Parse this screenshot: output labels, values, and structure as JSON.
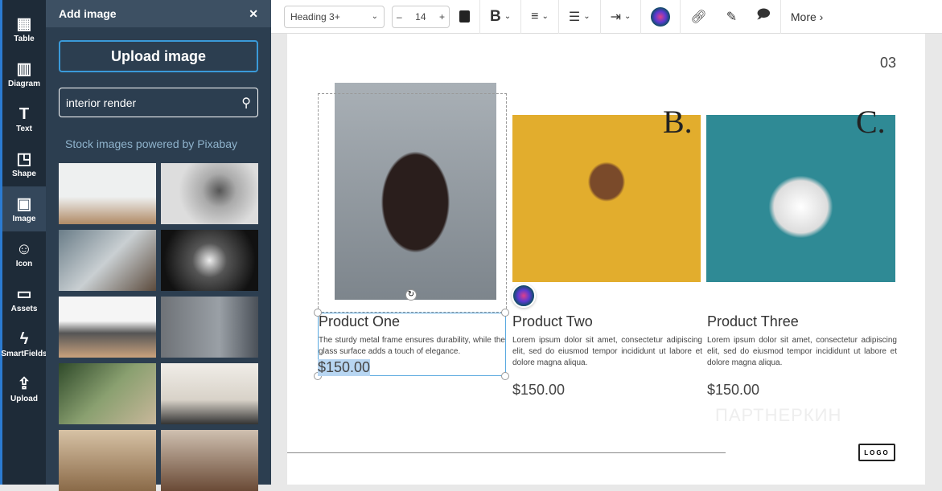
{
  "rail": [
    {
      "label": "Table",
      "icon": "▦"
    },
    {
      "label": "Diagram",
      "icon": "▥"
    },
    {
      "label": "Text",
      "icon": "T"
    },
    {
      "label": "Shape",
      "icon": "◳"
    },
    {
      "label": "Image",
      "icon": "▣"
    },
    {
      "label": "Icon",
      "icon": "☺"
    },
    {
      "label": "Assets",
      "icon": "▭"
    },
    {
      "label": "SmartFields",
      "icon": "ϟ"
    },
    {
      "label": "Upload",
      "icon": "⇪"
    }
  ],
  "panel": {
    "title": "Add image",
    "close": "✕",
    "upload": "Upload image",
    "search_value": "interior render",
    "pixabay": "Stock images powered by Pixabay"
  },
  "toolbar": {
    "style": "Heading 3+",
    "size": "14",
    "minus": "–",
    "plus": "+",
    "bold": "B",
    "more": "More ›"
  },
  "page": {
    "number": "03",
    "watermark": "ПАРТНЕРКИН",
    "logo": "LOGO",
    "products": [
      {
        "letter": "",
        "title": "Product One",
        "desc": "The sturdy metal frame ensures durability, while the glass surface adds a touch of elegance.",
        "price": "$150.00"
      },
      {
        "letter": "B.",
        "title": "Product Two",
        "desc": "Lorem ipsum dolor sit amet, consectetur adipiscing elit, sed do eiusmod tempor incididunt ut labore et dolore magna aliqua.",
        "price": "$150.00"
      },
      {
        "letter": "C.",
        "title": "Product Three",
        "desc": "Lorem ipsum dolor sit amet, consectetur adipiscing elit, sed do eiusmod tempor incididunt ut labore et dolore magna aliqua.",
        "price": "$150.00"
      }
    ]
  }
}
